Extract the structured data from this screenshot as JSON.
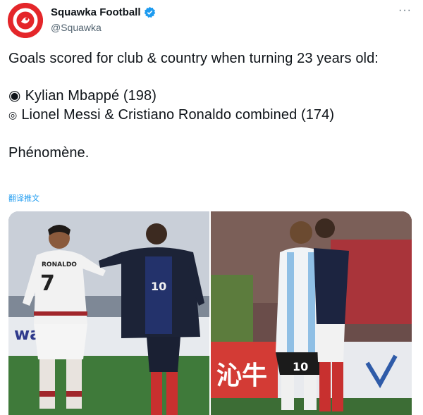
{
  "author": {
    "name": "Squawka Football",
    "handle": "@Squawka",
    "verified": true,
    "avatar_color": "#e4262a"
  },
  "menu": {
    "more_label": "···"
  },
  "tweet": {
    "line1": "Goals scored for club & country when turning 23 years old:",
    "bullets": [
      {
        "icon": "◉",
        "text": "Kylian Mbappé (198)"
      },
      {
        "icon": "◎",
        "text": "Lionel Messi & Cristiano Ronaldo combined (174)"
      }
    ],
    "closing": "Phénomène.",
    "translate_label": "翻译推文"
  },
  "media": {
    "left": {
      "shirt_number_left": "7",
      "shirt_name_left": "RONALDO",
      "shirt_number_right": "10",
      "board_text": "wa  en"
    },
    "right": {
      "shirt_number": "10",
      "board_text": "沁牛"
    }
  },
  "colors": {
    "accent": "#1d9bf0",
    "text": "#0f1419",
    "muted": "#536471"
  }
}
